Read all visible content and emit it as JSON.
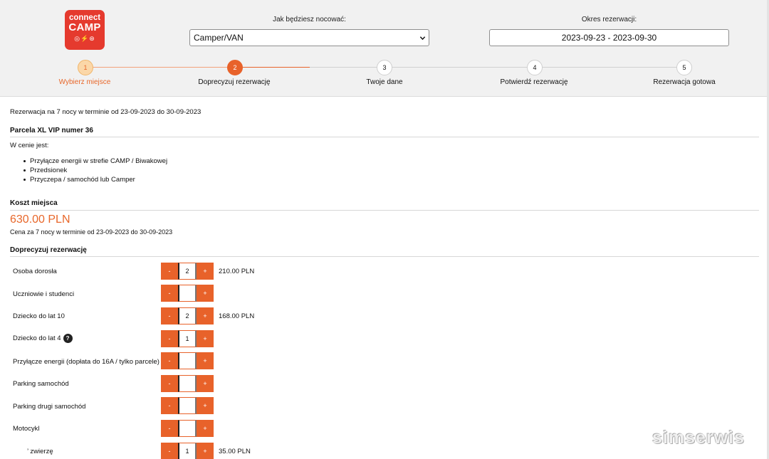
{
  "logo": {
    "line1": "connect",
    "line2": "CAMP",
    "icons": "◎⚡⊛"
  },
  "search": {
    "accommodation_label": "Jak będziesz nocować:",
    "accommodation_value": "Camper/VAN",
    "period_label": "Okres rezerwacji:",
    "period_value": "2023-09-23 - 2023-09-30"
  },
  "steps": [
    {
      "num": "1",
      "label": "Wybierz miejsce",
      "state": "done"
    },
    {
      "num": "2",
      "label": "Doprecyzuj rezerwację",
      "state": "active"
    },
    {
      "num": "3",
      "label": "Twoje dane",
      "state": "todo"
    },
    {
      "num": "4",
      "label": "Potwierdź rezerwację",
      "state": "todo"
    },
    {
      "num": "5",
      "label": "Rezerwacja gotowa",
      "state": "todo"
    }
  ],
  "summary": "Rezerwacja na 7 nocy w terminie od 23-09-2023 do 30-09-2023",
  "pitch": {
    "title": "Parcela XL VIP numer 36",
    "included_label": "W cenie jest:",
    "included": [
      "Przyłącze energii w strefie CAMP / Biwakowej",
      "Przedsionek",
      "Przyczepa / samochód lub Camper"
    ]
  },
  "cost": {
    "title": "Koszt miejsca",
    "price": "630.00 PLN",
    "note": "Cena za 7 nocy w terminie od 23-09-2023 do 30-09-2023"
  },
  "refine": {
    "title": "Doprecyzuj rezerwację",
    "minus": "-",
    "plus": "+",
    "help": "?",
    "rows": [
      {
        "label": "Osoba dorosła",
        "qty": "2",
        "price": "210.00 PLN"
      },
      {
        "label": "Uczniowie i studenci",
        "qty": "",
        "price": ""
      },
      {
        "label": "Dziecko do lat 10",
        "qty": "2",
        "price": "168.00 PLN"
      },
      {
        "label": "Dziecko do lat 4",
        "qty": "1",
        "price": ""
      },
      {
        "label": "Przyłącze energii (dopłata do 16A / tylko parcele)",
        "qty": "",
        "price": ""
      },
      {
        "label": "Parking samochód",
        "qty": "",
        "price": ""
      },
      {
        "label": "Parking drugi samochód",
        "qty": "",
        "price": ""
      },
      {
        "label": "Motocykl",
        "qty": "",
        "price": ""
      },
      {
        "label": "’ zwierzę",
        "qty": "1",
        "price": "35.00 PLN"
      }
    ]
  },
  "watermark": "simserwis",
  "colors": {
    "accent": "#e8622a",
    "brand_red": "#e53a2e",
    "step_done": "#fbd7a8"
  }
}
